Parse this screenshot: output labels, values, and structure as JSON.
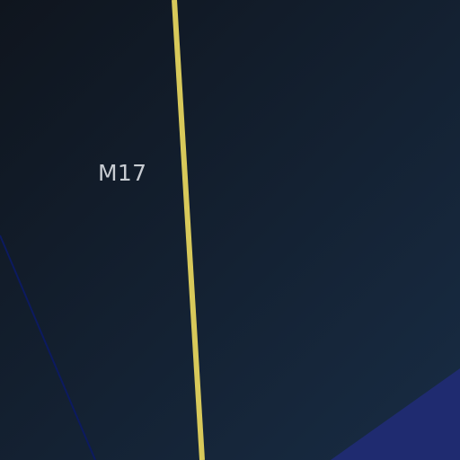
{
  "map": {
    "object_label": "M17",
    "colors": {
      "background_dark": "#0f151e",
      "background_light": "#182c44",
      "meridian_line": "#d8c95a",
      "boundary_line": "#0c1a60",
      "region_fill": "#1f2b70",
      "label_text": "#c8ccd2"
    }
  }
}
